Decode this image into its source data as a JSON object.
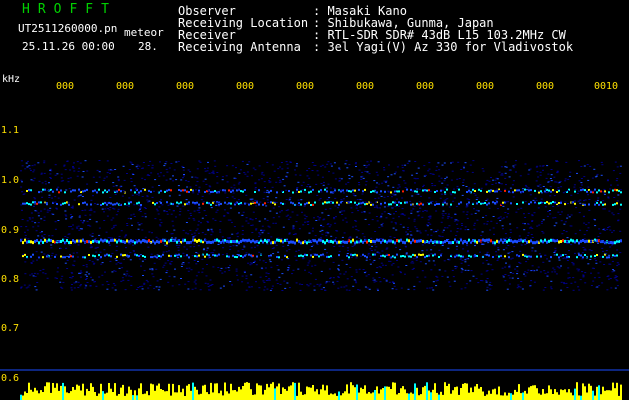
{
  "header": {
    "brand": "HROFFT",
    "file_name": "UT2511260000.pn",
    "mode": "meteor",
    "datetime": "25.11.26 00:00",
    "count": "28.",
    "rows": [
      {
        "label": "Observer",
        "value": ": Masaki Kano"
      },
      {
        "label": "Receiving Location",
        "value": ": Shibukawa, Gunma, Japan"
      },
      {
        "label": "Receiver",
        "value": ": RTL-SDR SDR# 43dB L15 103.2MHz CW"
      },
      {
        "label": "Receiving Antenna",
        "value": ": 3el Yagi(V) Az 330 for Vladivostok"
      }
    ]
  },
  "axes": {
    "y_unit": "kHz",
    "y_ticks": [
      "1.1",
      "1.0",
      "0.9",
      "0.8",
      "0.7",
      "0.6"
    ],
    "x_ticks": [
      "000",
      "000",
      "000",
      "000",
      "000",
      "000",
      "000",
      "000",
      "000",
      "0010"
    ]
  },
  "spectrogram": {
    "frequency_range_khz": [
      0.6,
      1.1
    ],
    "bands": [
      {
        "center_khz": 0.88,
        "description": "strong continuous band"
      },
      {
        "center_khz": 0.955,
        "description": "upper band"
      },
      {
        "center_khz": 0.98,
        "description": "faint band"
      },
      {
        "center_khz": 0.85,
        "description": "lower band"
      }
    ],
    "colors": {
      "background": "#000000",
      "noise_low": "#00008a",
      "noise_mid": "#1a4dff",
      "signal_mid": "#00ffff",
      "signal_high": "#ffff00",
      "signal_peak": "#ff2000",
      "tick_color": "#ffe100",
      "baseline_color": "#ffff00",
      "baseline_edge": "#00ffff"
    }
  }
}
